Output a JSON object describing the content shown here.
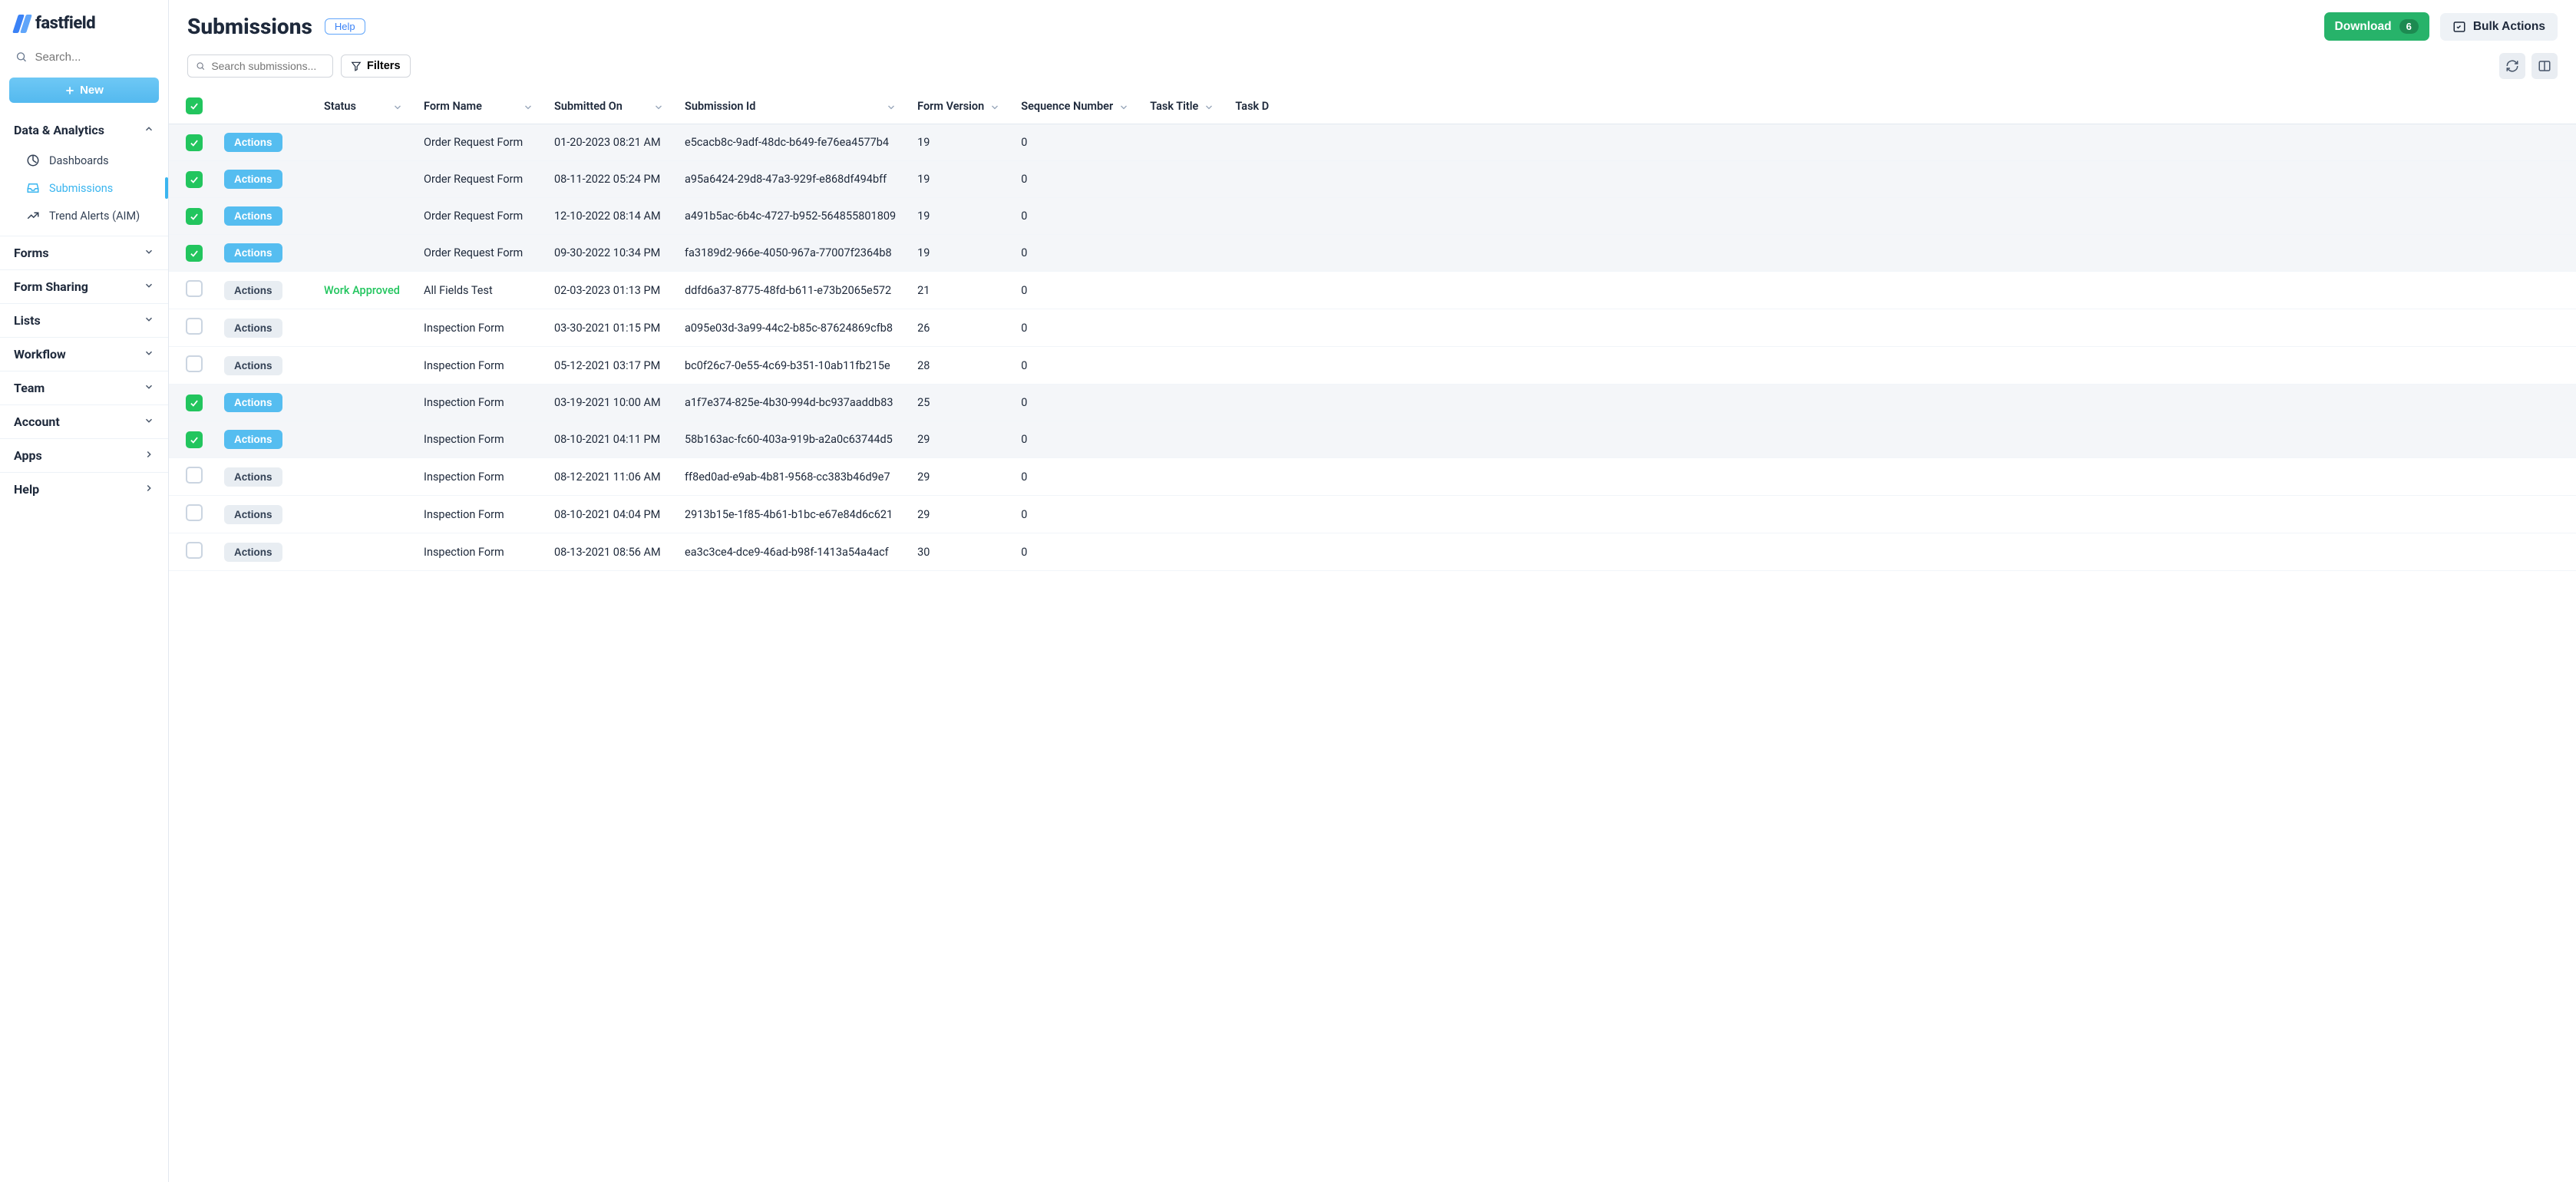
{
  "brand": {
    "name": "fastfield"
  },
  "globalSearch": {
    "placeholder": "Search..."
  },
  "newButton": {
    "label": "New"
  },
  "sidebar": {
    "sections": [
      {
        "label": "Data & Analytics",
        "expanded": true,
        "items": [
          {
            "label": "Dashboards",
            "icon": "dashboard"
          },
          {
            "label": "Submissions",
            "icon": "inbox",
            "active": true
          },
          {
            "label": "Trend Alerts (AIM)",
            "icon": "trend"
          }
        ]
      },
      {
        "label": "Forms",
        "expanded": false
      },
      {
        "label": "Form Sharing",
        "expanded": false
      },
      {
        "label": "Lists",
        "expanded": false
      },
      {
        "label": "Workflow",
        "expanded": false
      },
      {
        "label": "Team",
        "expanded": false
      },
      {
        "label": "Account",
        "expanded": false
      },
      {
        "label": "Apps",
        "chevron": "right"
      },
      {
        "label": "Help",
        "chevron": "right"
      }
    ]
  },
  "header": {
    "title": "Submissions",
    "help": "Help",
    "download": {
      "label": "Download",
      "count": "6"
    },
    "bulk": "Bulk Actions"
  },
  "toolbar": {
    "searchPlaceholder": "Search submissions...",
    "filters": "Filters"
  },
  "columns": [
    "Status",
    "Form Name",
    "Submitted On",
    "Submission Id",
    "Form Version",
    "Sequence Number",
    "Task Title",
    "Task D"
  ],
  "actionsLabel": "Actions",
  "rows": [
    {
      "sel": true,
      "status": "",
      "form": "Order Request Form",
      "date": "01-20-2023 08:21 AM",
      "id": "e5cacb8c-9adf-48dc-b649-fe76ea4577b4",
      "ver": "19",
      "seq": "0",
      "tt": ""
    },
    {
      "sel": true,
      "status": "",
      "form": "Order Request Form",
      "date": "08-11-2022 05:24 PM",
      "id": "a95a6424-29d8-47a3-929f-e868df494bff",
      "ver": "19",
      "seq": "0",
      "tt": ""
    },
    {
      "sel": true,
      "status": "",
      "form": "Order Request Form",
      "date": "12-10-2022 08:14 AM",
      "id": "a491b5ac-6b4c-4727-b952-564855801809",
      "ver": "19",
      "seq": "0",
      "tt": ""
    },
    {
      "sel": true,
      "status": "",
      "form": "Order Request Form",
      "date": "09-30-2022 10:34 PM",
      "id": "fa3189d2-966e-4050-967a-77007f2364b8",
      "ver": "19",
      "seq": "0",
      "tt": ""
    },
    {
      "sel": false,
      "status": "Work Approved",
      "form": "All Fields Test",
      "date": "02-03-2023 01:13 PM",
      "id": "ddfd6a37-8775-48fd-b611-e73b2065e572",
      "ver": "21",
      "seq": "0",
      "tt": ""
    },
    {
      "sel": false,
      "status": "",
      "form": "Inspection Form",
      "date": "03-30-2021 01:15 PM",
      "id": "a095e03d-3a99-44c2-b85c-87624869cfb8",
      "ver": "26",
      "seq": "0",
      "tt": ""
    },
    {
      "sel": false,
      "status": "",
      "form": "Inspection Form",
      "date": "05-12-2021 03:17 PM",
      "id": "bc0f26c7-0e55-4c69-b351-10ab11fb215e",
      "ver": "28",
      "seq": "0",
      "tt": ""
    },
    {
      "sel": true,
      "status": "",
      "form": "Inspection Form",
      "date": "03-19-2021 10:00 AM",
      "id": "a1f7e374-825e-4b30-994d-bc937aaddb83",
      "ver": "25",
      "seq": "0",
      "tt": ""
    },
    {
      "sel": true,
      "status": "",
      "form": "Inspection Form",
      "date": "08-10-2021 04:11 PM",
      "id": "58b163ac-fc60-403a-919b-a2a0c63744d5",
      "ver": "29",
      "seq": "0",
      "tt": ""
    },
    {
      "sel": false,
      "status": "",
      "form": "Inspection Form",
      "date": "08-12-2021 11:06 AM",
      "id": "ff8ed0ad-e9ab-4b81-9568-cc383b46d9e7",
      "ver": "29",
      "seq": "0",
      "tt": ""
    },
    {
      "sel": false,
      "status": "",
      "form": "Inspection Form",
      "date": "08-10-2021 04:04 PM",
      "id": "2913b15e-1f85-4b61-b1bc-e67e84d6c621",
      "ver": "29",
      "seq": "0",
      "tt": ""
    },
    {
      "sel": false,
      "status": "",
      "form": "Inspection Form",
      "date": "08-13-2021 08:56 AM",
      "id": "ea3c3ce4-dce9-46ad-b98f-1413a54a4acf",
      "ver": "30",
      "seq": "0",
      "tt": ""
    }
  ]
}
